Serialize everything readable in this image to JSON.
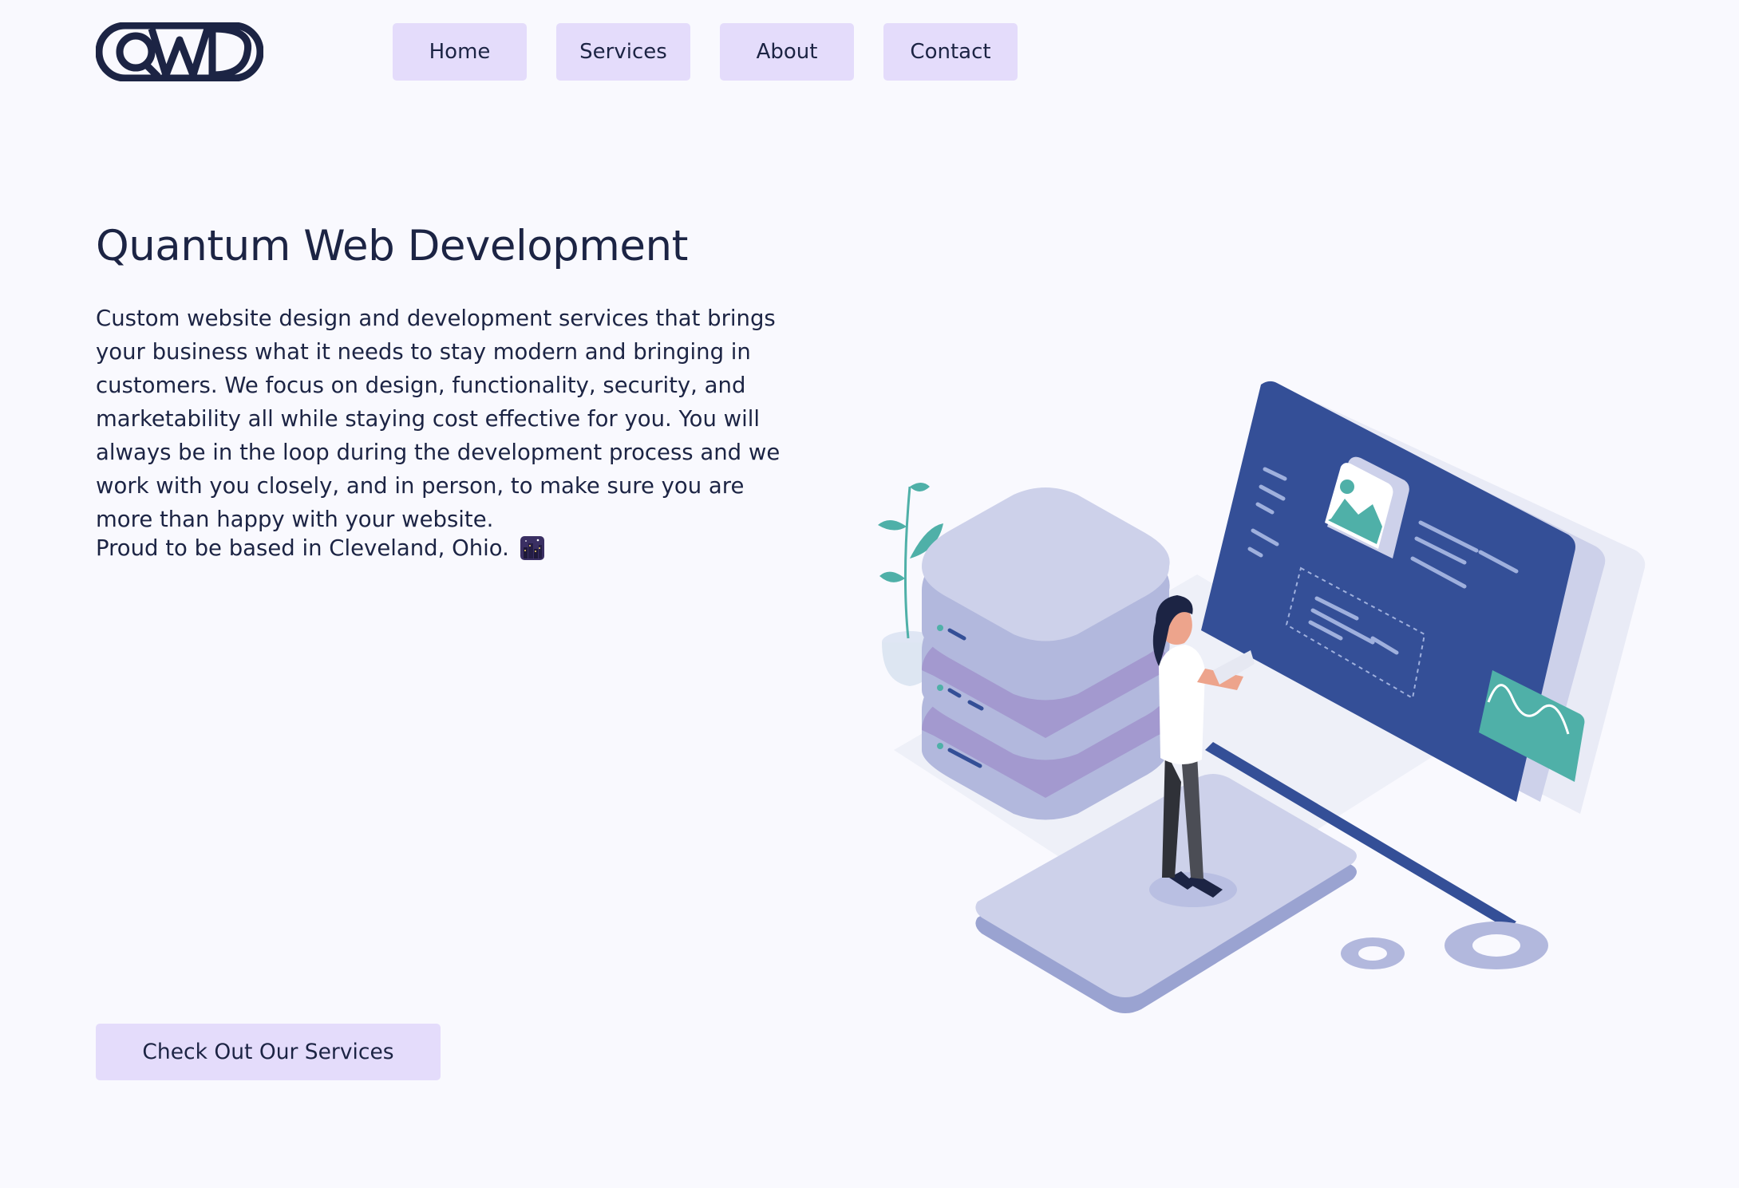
{
  "header": {
    "logo_text": "QWD",
    "nav": [
      {
        "label": "Home"
      },
      {
        "label": "Services"
      },
      {
        "label": "About"
      },
      {
        "label": "Contact"
      }
    ]
  },
  "hero": {
    "title": "Quantum Web Development",
    "description": "Custom website design and development services that brings your business what it needs to stay modern and bringing in customers. We focus on design, functionality, security, and marketability all while staying cost effective for you. You will always be in the loop during the development process and we work with you closely, and in person, to make sure you are more than happy with your website.",
    "location": "Proud to be based in Cleveland, Ohio.",
    "location_icon": "city-night-icon",
    "cta_label": "Check Out Our Services"
  },
  "illustration": {
    "name": "developer-illustration"
  },
  "colors": {
    "background": "#f9f9fe",
    "button_bg": "#e4dcfb",
    "text": "#1c2444",
    "accent_navy": "#344f97",
    "accent_teal": "#4fb0a8",
    "accent_lavender": "#cdd1ea"
  }
}
